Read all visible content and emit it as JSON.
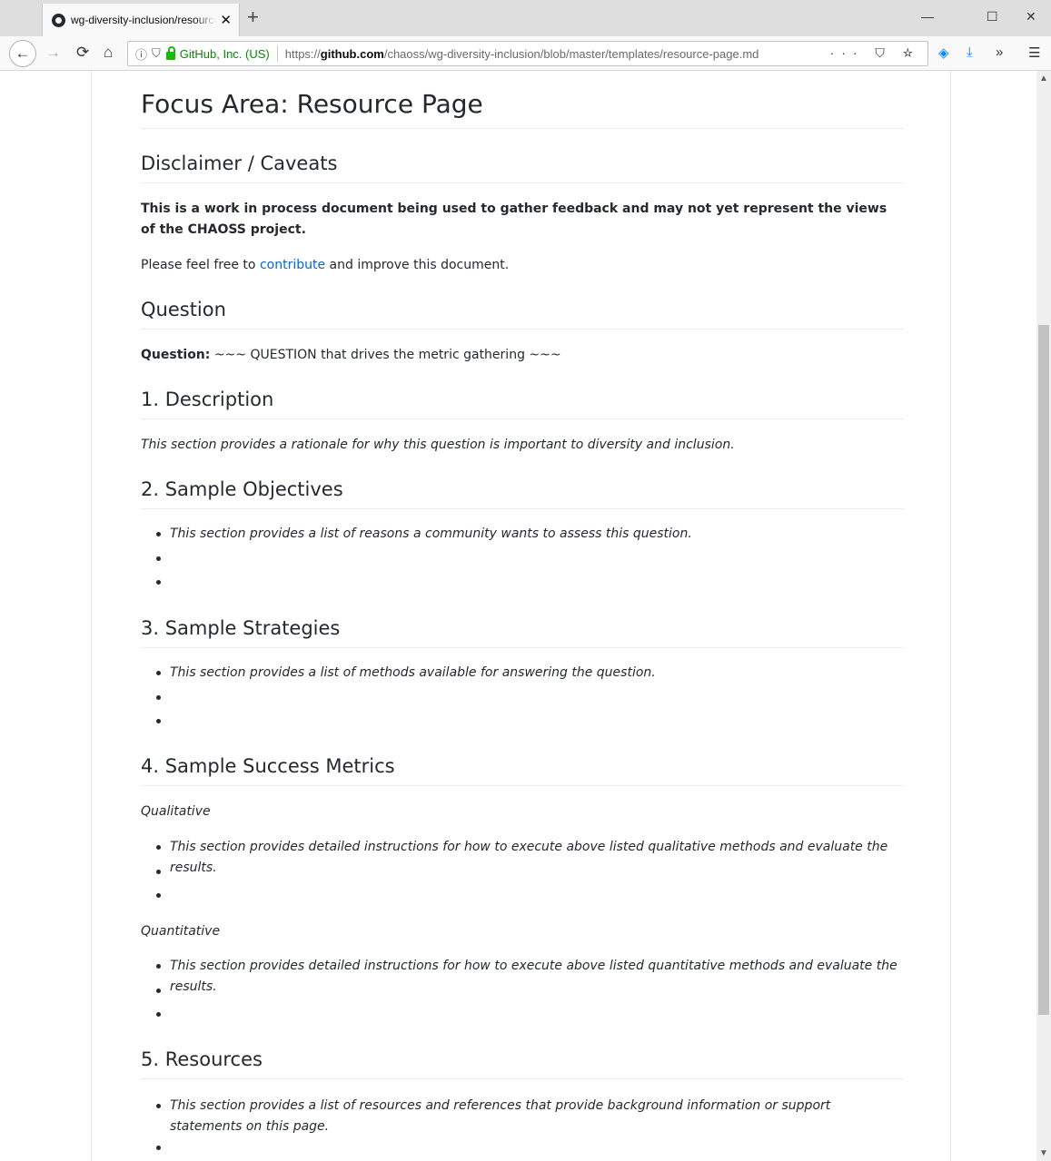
{
  "browser": {
    "tab_title": "wg-diversity-inclusion/resource-page",
    "tab_close": "✕",
    "new_tab": "+",
    "site_identity": "GitHub, Inc. (US)",
    "url_prefix": "https://",
    "url_host": "github.com",
    "url_path": "/chaoss/wg-diversity-inclusion/blob/master/templates/resource-page.md",
    "page_actions": "··· ⛉ ☆",
    "window_controls": {
      "minimize": "—",
      "maximize": "☐",
      "close": "✕"
    }
  },
  "doc": {
    "title": "Focus Area: Resource Page",
    "disclaimer": {
      "heading": "Disclaimer / Caveats",
      "bold_text": "This is a work in process document being used to gather feedback and may not yet represent the views of the CHAOSS project.",
      "text_before": "Please feel free to ",
      "link": "contribute",
      "text_after": " and improve this document."
    },
    "question": {
      "heading": "Question",
      "label": "Question:",
      "text": " ~~~ QUESTION that drives the metric gathering ~~~"
    },
    "description": {
      "heading": "1. Description",
      "text": "This section provides a rationale for why this question is important to diversity and inclusion."
    },
    "objectives": {
      "heading": "2. Sample Objectives",
      "items": [
        "This section provides a list of reasons a community wants to assess this question.",
        "",
        ""
      ]
    },
    "strategies": {
      "heading": "3. Sample Strategies",
      "items": [
        "This section provides a list of methods available for answering the question.",
        "",
        ""
      ]
    },
    "metrics": {
      "heading": "4. Sample Success Metrics",
      "qualitative_label": "Qualitative",
      "qualitative_items": [
        "This section provides detailed instructions for how to execute above listed qualitative methods and evaluate the results.",
        "",
        ""
      ],
      "quantitative_label": "Quantitative",
      "quantitative_items": [
        "This section provides detailed instructions for how to execute above listed quantitative methods and evaluate the results.",
        "",
        ""
      ]
    },
    "resources": {
      "heading": "5. Resources",
      "items": [
        "This section provides a list of resources and references that provide background information or support statements on this page.",
        ""
      ]
    }
  }
}
